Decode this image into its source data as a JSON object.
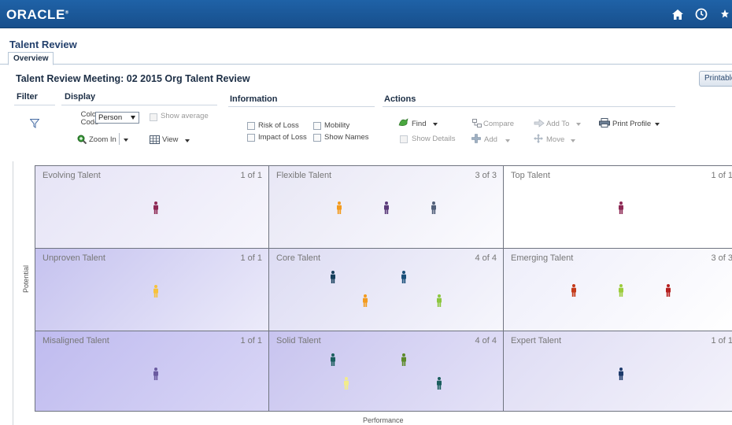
{
  "header": {
    "brand": "ORACLE",
    "brand_mark": "®",
    "icons": [
      "home-icon",
      "clock-icon",
      "star-icon"
    ],
    "bar_color": "#1b5a9b"
  },
  "page": {
    "title": "Talent Review",
    "tabs": [
      {
        "label": "Overview",
        "active": true
      }
    ]
  },
  "meeting_title": "Talent Review Meeting: 02 2015 Org Talent Review",
  "printable_label": "Printable",
  "toolbar": {
    "filter": {
      "heading": "Filter",
      "icon": "funnel-icon"
    },
    "display": {
      "heading": "Display",
      "color_code_label": "Color Code",
      "color_code_value": "Person",
      "show_average": "Show average",
      "zoom_in": "Zoom In",
      "view": "View"
    },
    "information": {
      "heading": "Information",
      "risk_of_loss": "Risk of Loss",
      "mobility": "Mobility",
      "impact_of_loss": "Impact of Loss",
      "show_names": "Show Names"
    },
    "actions": {
      "heading": "Actions",
      "find": "Find",
      "compare": "Compare",
      "add_to": "Add To",
      "print_profile": "Print Profile",
      "show_details": "Show Details",
      "add": "Add",
      "move": "Move"
    }
  },
  "grid": {
    "y_axis_label": "Potential",
    "x_axis_label": "Performance",
    "cells": [
      {
        "name": "Evolving Talent",
        "count": "1 of 1",
        "colors": [
          "#8e2a55"
        ]
      },
      {
        "name": "Flexible Talent",
        "count": "3 of 3",
        "colors": [
          "#f39b1e",
          "#5b3b7a",
          "#52607a"
        ]
      },
      {
        "name": "Top Talent",
        "count": "1 of 1",
        "colors": [
          "#8e2a55"
        ]
      },
      {
        "name": "Unproven Talent",
        "count": "1 of 1",
        "colors": [
          "#f7c23b"
        ]
      },
      {
        "name": "Core Talent",
        "count": "4 of 4",
        "colors": [
          "#163f5c",
          "#1a4f7a",
          "#f39b1e",
          "#8cc63f"
        ]
      },
      {
        "name": "Emerging Talent",
        "count": "3 of 3",
        "colors": [
          "#c43a1a",
          "#9ccc3c",
          "#b52020"
        ]
      },
      {
        "name": "Misaligned Talent",
        "count": "1 of 1",
        "colors": [
          "#6a5aa0"
        ]
      },
      {
        "name": "Solid Talent",
        "count": "4 of 4",
        "colors": [
          "#1b5e5e",
          "#5c8a2a",
          "#f2ec8a",
          "#1b5e5e"
        ]
      },
      {
        "name": "Expert Talent",
        "count": "1 of 1",
        "colors": [
          "#1d3a6b"
        ]
      }
    ]
  }
}
